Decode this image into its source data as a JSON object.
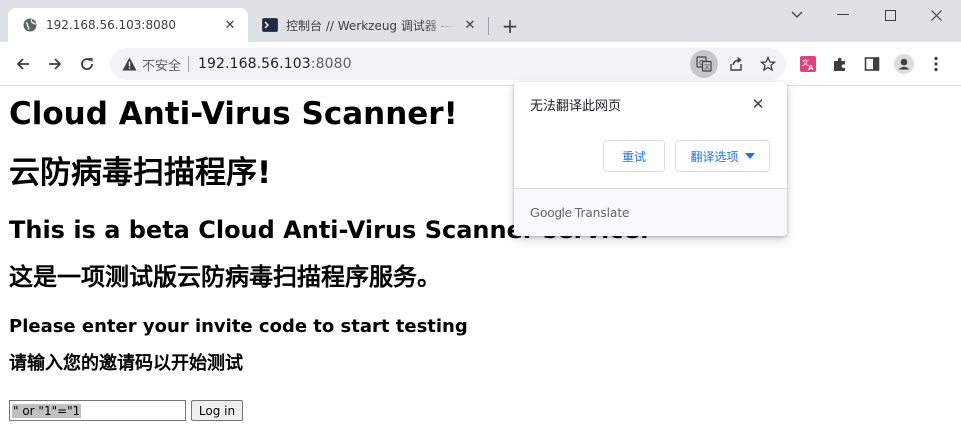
{
  "browser": {
    "tabs": [
      {
        "title": "192.168.56.103:8080",
        "active": true,
        "icon": "globe-icon"
      },
      {
        "title": "控制台 // Werkzeug 调试器 ---",
        "active": false,
        "icon": "terminal-icon"
      }
    ],
    "address_bar": {
      "security_label": "不安全",
      "host": "192.168.56.103",
      "port": ":8080"
    }
  },
  "translate_popup": {
    "message": "无法翻译此网页",
    "retry_label": "重试",
    "options_label": "翻译选项",
    "footer_brand": "Google",
    "footer_product": "Translate"
  },
  "page": {
    "title_en": "Cloud Anti-Virus Scanner!",
    "title_zh": "云防病毒扫描程序!",
    "subtitle_en": "This is a beta Cloud Anti-Virus Scanner service.",
    "subtitle_zh": "这是一项测试版云防病毒扫描程序服务。",
    "prompt_en": "Please enter your invite code to start testing",
    "prompt_zh": "请输入您的邀请码以开始测试",
    "invite_value": "\" or \"1\"=\"1",
    "login_label": "Log in"
  },
  "colors": {
    "tabstrip_bg": "#dee1e6",
    "accent_blue": "#1a73e8",
    "extension_pink": "#e0427f"
  }
}
